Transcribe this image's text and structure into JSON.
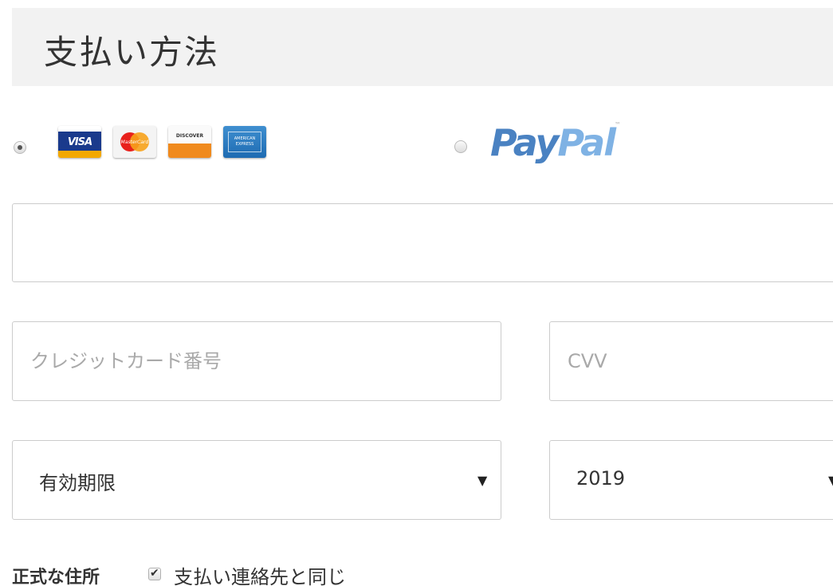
{
  "header": {
    "title": "支払い方法"
  },
  "payment_options": {
    "card_selected": true,
    "paypal_selected": false,
    "cards": [
      {
        "name": "visa-icon",
        "label": "VISA"
      },
      {
        "name": "mastercard-icon",
        "label": "MasterCard"
      },
      {
        "name": "discover-icon",
        "label": "DISCOVER"
      },
      {
        "name": "amex-icon",
        "label": "AMERICAN EXPRESS"
      }
    ],
    "paypal_logo": {
      "pay": "Pay",
      "pal": "Pal",
      "tm": "™"
    }
  },
  "form": {
    "name_field": {
      "value": "",
      "placeholder": ""
    },
    "cc_number": {
      "value": "",
      "placeholder": "クレジットカード番号"
    },
    "cvv": {
      "value": "",
      "placeholder": "CVV"
    },
    "expiry_month": {
      "selected": "有効期限",
      "arrow": "▼"
    },
    "expiry_year": {
      "selected": "2019",
      "arrow": "▼"
    }
  },
  "billing": {
    "label": "正式な住所",
    "same_as_contact_checked": true,
    "check_glyph": "✔",
    "same_as_contact_label": "支払い連絡先と同じ"
  },
  "colors": {
    "header_bg": "#f2f2f2",
    "paypal_dark": "#4a82c2",
    "paypal_light": "#7fb2e4",
    "border": "#cccccc"
  }
}
